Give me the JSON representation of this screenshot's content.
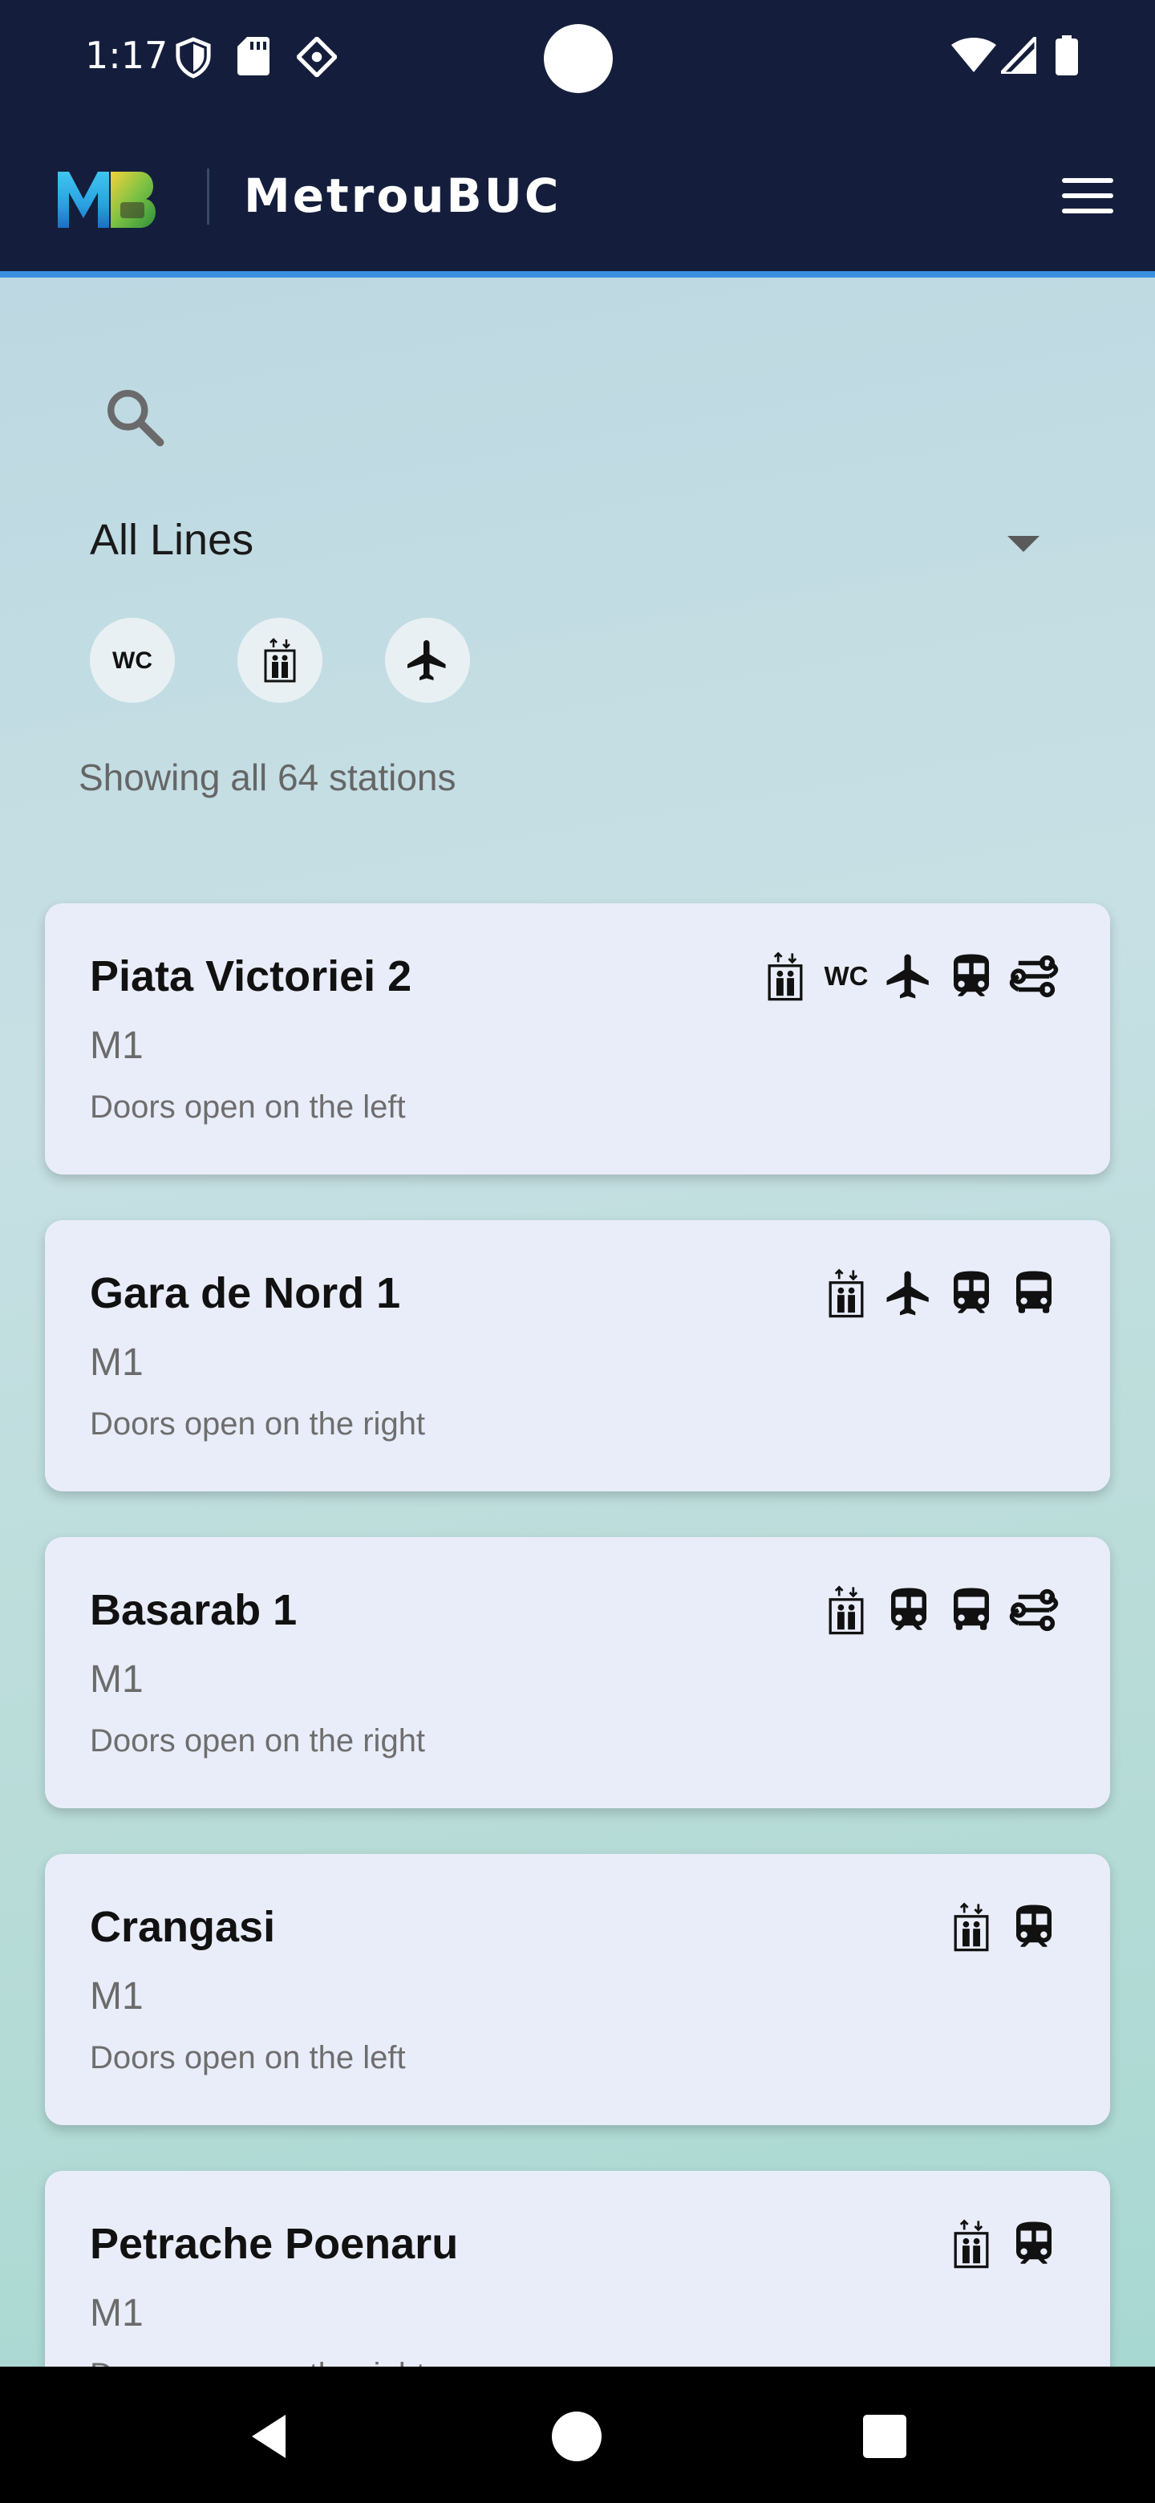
{
  "status_bar": {
    "time": "1:17",
    "icons": [
      "shield-icon",
      "sd-card-icon",
      "location-icon",
      "wifi-icon",
      "signal-icon",
      "battery-icon"
    ]
  },
  "app_bar": {
    "title": "MetrouBUC",
    "logo_text": "MB",
    "menu_icon": "hamburger-menu-icon"
  },
  "search": {
    "icon": "search-icon"
  },
  "line_filter": {
    "selected": "All Lines"
  },
  "amenity_filters": [
    {
      "icon": "wc-icon",
      "label": "WC"
    },
    {
      "icon": "elevator-icon"
    },
    {
      "icon": "airplane-icon"
    }
  ],
  "results_text": "Showing all 64 stations",
  "stations": [
    {
      "name": "Piata Victoriei 2",
      "line": "M1",
      "doors": "Doors open on the left",
      "amenities": [
        "elevator-icon",
        "wc-icon",
        "airplane-icon",
        "train-icon",
        "transfer-icon"
      ]
    },
    {
      "name": "Gara de Nord 1",
      "line": "M1",
      "doors": "Doors open on the right",
      "amenities": [
        "elevator-icon",
        "airplane-icon",
        "train-icon",
        "bus-icon"
      ]
    },
    {
      "name": "Basarab 1",
      "line": "M1",
      "doors": "Doors open on the right",
      "amenities": [
        "elevator-icon",
        "train-icon",
        "bus-icon",
        "transfer-icon"
      ]
    },
    {
      "name": "Crangasi",
      "line": "M1",
      "doors": "Doors open on the left",
      "amenities": [
        "elevator-icon",
        "train-icon"
      ]
    },
    {
      "name": "Petrache Poenaru",
      "line": "M1",
      "doors": "Doors open on the right",
      "amenities": [
        "elevator-icon",
        "train-icon"
      ]
    }
  ],
  "nav_bar": {
    "icons": [
      "back-icon",
      "home-icon",
      "recents-icon"
    ]
  },
  "colors": {
    "app_bar": "#141e3c",
    "accent": "#3b8fe0",
    "card": "#e9edf9"
  }
}
